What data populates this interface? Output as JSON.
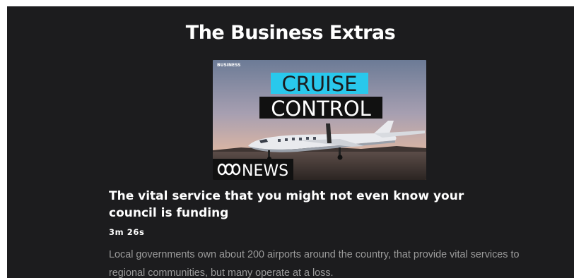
{
  "section": {
    "title": "The Business Extras"
  },
  "episode": {
    "thumbnail": {
      "corner_label": "BUSINESS",
      "headline_line1": "CRUISE",
      "headline_line2": "CONTROL",
      "brand_logo_text": "NEWS",
      "brand_icon": "abc-logo-icon",
      "headline_highlight_color": "#29c8ec"
    },
    "title": "The vital service that you might not even know your council is funding",
    "duration": "3m 26s",
    "description": "Local governments own about 200 airports around the country, that provide vital services to regional communities, but many operate at a loss."
  }
}
